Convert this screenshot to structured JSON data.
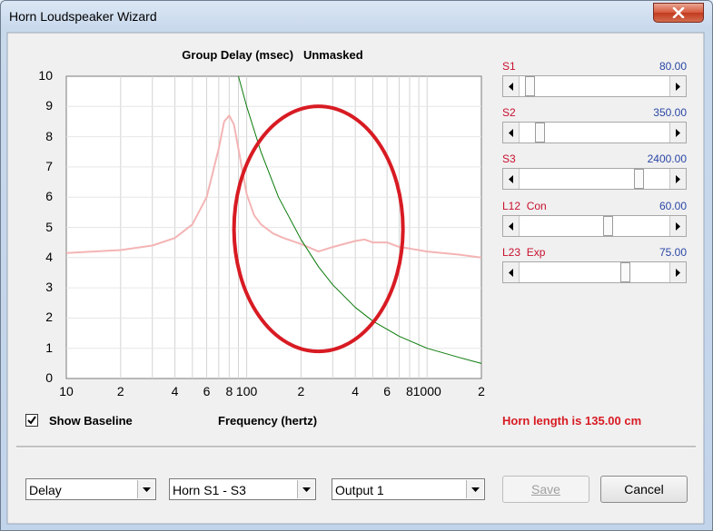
{
  "window": {
    "title": "Horn Loudspeaker Wizard"
  },
  "chart": {
    "title": "Group Delay (msec)   Unmasked",
    "xlabel": "Frequency (hertz)",
    "yticks": [
      "0",
      "1",
      "2",
      "3",
      "4",
      "5",
      "6",
      "7",
      "8",
      "9",
      "10"
    ],
    "xticks": [
      "10",
      "2",
      "4",
      "6",
      "8",
      "100",
      "2",
      "4",
      "6",
      "8",
      "1000",
      "2"
    ]
  },
  "chart_data": {
    "type": "line",
    "title": "Group Delay (msec)   Unmasked",
    "xlabel": "Frequency (hertz)",
    "ylabel": "",
    "xscale": "log",
    "xlim": [
      10,
      2000
    ],
    "ylim": [
      0,
      10
    ],
    "grid": true,
    "series": [
      {
        "color": "#f4b4b4",
        "x": [
          10,
          20,
          30,
          40,
          50,
          60,
          70,
          75,
          80,
          85,
          90,
          100,
          110,
          120,
          140,
          160,
          200,
          250,
          300,
          400,
          450,
          500,
          600,
          700,
          800,
          1000,
          1500,
          2000
        ],
        "y": [
          4.15,
          4.25,
          4.4,
          4.65,
          5.1,
          6.0,
          7.6,
          8.5,
          8.7,
          8.4,
          7.6,
          6.1,
          5.4,
          5.1,
          4.8,
          4.65,
          4.45,
          4.2,
          4.35,
          4.55,
          4.6,
          4.5,
          4.5,
          4.35,
          4.3,
          4.2,
          4.1,
          4.0
        ]
      },
      {
        "color": "#0a7a0a",
        "x": [
          90,
          100,
          120,
          150,
          200,
          250,
          300,
          400,
          500,
          700,
          1000,
          1500,
          2000
        ],
        "y": [
          10.0,
          9.0,
          7.5,
          6.0,
          4.6,
          3.7,
          3.1,
          2.35,
          1.9,
          1.4,
          1.0,
          0.7,
          0.5
        ]
      }
    ],
    "annotation": {
      "shape": "ellipse",
      "color": "#d81b23",
      "center_x": 250,
      "center_y": 4.95,
      "description": "red highlight ellipse"
    }
  },
  "controls": {
    "show_baseline": {
      "label": "Show Baseline",
      "checked": true
    },
    "horn_length": "Horn length is 135.00 cm"
  },
  "sliders": [
    {
      "label": "S1",
      "value": "80.00",
      "position": 0.04
    },
    {
      "label": "S2",
      "value": "350.00",
      "position": 0.11
    },
    {
      "label": "S3",
      "value": "2400.00",
      "position": 0.82
    },
    {
      "label": "L12  Con",
      "value": "60.00",
      "position": 0.6
    },
    {
      "label": "L23  Exp",
      "value": "75.00",
      "position": 0.72
    }
  ],
  "dropdowns": [
    {
      "value": "Delay"
    },
    {
      "value": "Horn S1 - S3"
    },
    {
      "value": "Output 1"
    }
  ],
  "buttons": {
    "save": "Save",
    "cancel": "Cancel"
  }
}
